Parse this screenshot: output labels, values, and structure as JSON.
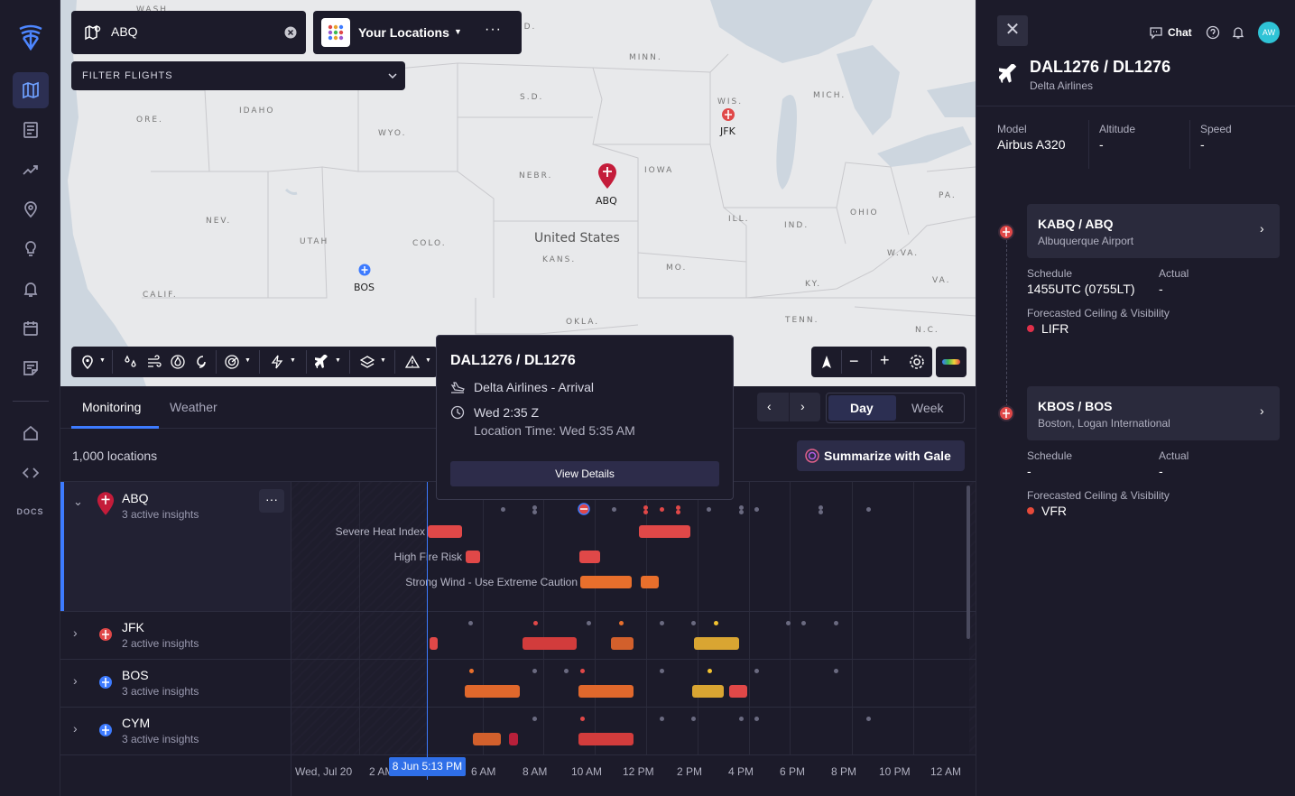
{
  "nav": {
    "docs": "DOCS"
  },
  "map": {
    "search_value": "ABQ",
    "locations_label": "Your Locations",
    "filter_label": "FILTER FLIGHTS",
    "country_label": "United States",
    "states": [
      "WASH.",
      "N.D.",
      "MINN.",
      "S.D.",
      "ORE.",
      "IDAHO",
      "WYO.",
      "WIS.",
      "MICH.",
      "NEBR.",
      "IOWA",
      "NEV.",
      "UTAH",
      "COLO.",
      "KANS.",
      "ILL.",
      "IND.",
      "OHIO",
      "PA.",
      "CALIF.",
      "MO.",
      "W.VA.",
      "VA.",
      "KY.",
      "OKLA.",
      "TENN.",
      "N.C."
    ],
    "pins": {
      "jfk": "JFK",
      "abq": "ABQ",
      "bos": "BOS"
    }
  },
  "popup": {
    "title": "DAL1276 / DL1276",
    "airline": "Delta Airlines - Arrival",
    "time": "Wed 2:35 Z",
    "local": "Location Time: Wed 5:35 AM",
    "button": "View Details"
  },
  "tabs": {
    "monitoring": "Monitoring",
    "weather": "Weather",
    "partial": "e",
    "day": "Day",
    "week": "Week"
  },
  "summary": {
    "count": "1,000 locations",
    "summarize": "Summarize with Gale"
  },
  "rows": [
    {
      "name": "ABQ",
      "sub": "3 active insights"
    },
    {
      "name": "JFK",
      "sub": "2 active insights"
    },
    {
      "name": "BOS",
      "sub": "3 active insights"
    },
    {
      "name": "CYM",
      "sub": "3 active insights"
    }
  ],
  "insights": [
    "Severe Heat Index",
    "High Fire Risk",
    "Strong Wind - Use Extreme Caution"
  ],
  "timeline": {
    "date": "Wed, Jul 20",
    "now": "8 Jun 5:13 PM",
    "ticks": [
      "2 AM",
      "6 AM",
      "8 AM",
      "10 AM",
      "12 PM",
      "2 PM",
      "4 PM",
      "6 PM",
      "8 PM",
      "10 PM",
      "12 AM"
    ]
  },
  "right": {
    "chat": "Chat",
    "avatar": "AW",
    "flight": "DAL1276 / DL1276",
    "airline": "Delta Airlines",
    "model_label": "Model",
    "model": "Airbus A320",
    "alt_label": "Altitude",
    "alt": "-",
    "speed_label": "Speed",
    "speed": "-",
    "origin": {
      "code": "KABQ / ABQ",
      "name": "Albuquerque Airport",
      "schedule_label": "Schedule",
      "schedule": "1455UTC (0755LT)",
      "actual_label": "Actual",
      "actual": "-",
      "fc_label": "Forecasted Ceiling & Visibility",
      "fc": "LIFR"
    },
    "dest": {
      "code": "KBOS / BOS",
      "name": "Boston, Logan International",
      "schedule_label": "Schedule",
      "schedule": "-",
      "actual_label": "Actual",
      "actual": "-",
      "fc_label": "Forecasted Ceiling & Visibility",
      "fc": "VFR"
    }
  },
  "colors": {
    "accent": "#3d7bff",
    "red": "#e04848",
    "orange": "#e86f2c",
    "yellow": "#d9a532",
    "lifr": "#e0304a",
    "vfr": "#e64a3a"
  }
}
